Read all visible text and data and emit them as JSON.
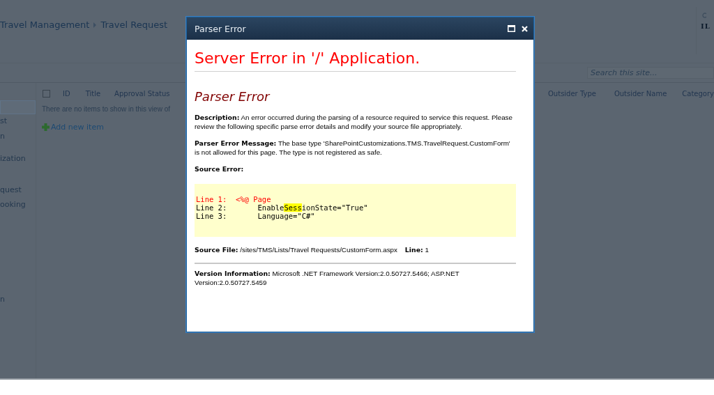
{
  "page": {
    "breadcrumb": [
      "Travel Management",
      "Travel Request"
    ],
    "header_right": "IL",
    "search": {
      "placeholder": "Search this site..."
    },
    "nav": [
      {
        "selected": true
      },
      {
        "label": "st",
        "selected": false
      },
      {
        "label": "n",
        "selected": false
      },
      {
        "label": "ization",
        "selected": false
      },
      {
        "label": "quest",
        "selected": false
      },
      {
        "label": "ooking",
        "selected": false
      },
      {
        "label": "n",
        "selected": false
      }
    ],
    "list": {
      "select_all_checked": false,
      "columns": [
        "ID",
        "Title",
        "Approval Status",
        "Outsider Type",
        "Outsider Name",
        "Category"
      ],
      "empty_message": "There are no items to show in this view of",
      "add_link": "Add new item"
    }
  },
  "dialog": {
    "title": "Parser Error",
    "heading": "Server Error in '/' Application.",
    "subheading": "Parser Error",
    "paragraphs": [
      "**Description:** An error occurred during the parsing of a resource required to service this request. Please review the following specific parse error details and modify your source file appropriately.",
      "**Parser Error Message:** The base type 'SharePointCustomizations.TMS.TravelRequest.CustomForm' is not allowed for this page. The type is not registered as safe."
    ],
    "source_error_label": "Source Error:",
    "code_lines": [
      {
        "number": "Line 1:",
        "error": true,
        "parts": [
          {
            "text": "<%@ Page",
            "highlighted": false
          }
        ]
      },
      {
        "number": "Line 2:",
        "error": false,
        "parts": [
          {
            "text": "     Enable",
            "highlighted": false
          },
          {
            "text": "Sess",
            "highlighted": true
          },
          {
            "text": "ionState=\"True\"",
            "highlighted": false
          }
        ]
      },
      {
        "number": "Line 3:",
        "error": false,
        "parts": [
          {
            "text": "     Language=\"C#\"",
            "highlighted": false
          }
        ]
      }
    ],
    "source_file": "**Source File:** /sites/TMS/Lists/Travel Requests/CustomForm.aspx    **Line:** 1",
    "version": "**Version Information:** Microsoft .NET Framework Version:2.0.50727.5466; ASP.NET Version:2.0.50727.5459"
  }
}
